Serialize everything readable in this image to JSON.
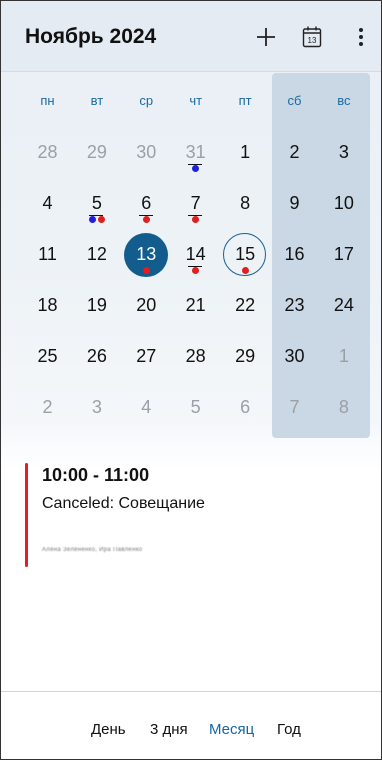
{
  "header": {
    "title": "Ноябрь 2024",
    "calendar_icon_number": "13"
  },
  "weekdays": [
    "пн",
    "вт",
    "ср",
    "чт",
    "пт",
    "сб",
    "вс"
  ],
  "weeks": [
    [
      {
        "n": "28",
        "muted": true
      },
      {
        "n": "29",
        "muted": true
      },
      {
        "n": "30",
        "muted": true
      },
      {
        "n": "31",
        "muted": true,
        "dots": [
          "blue"
        ],
        "underline": true
      },
      {
        "n": "1"
      },
      {
        "n": "2"
      },
      {
        "n": "3"
      }
    ],
    [
      {
        "n": "4"
      },
      {
        "n": "5",
        "dots": [
          "blue",
          "red"
        ],
        "underline": true
      },
      {
        "n": "6",
        "dots": [
          "red"
        ],
        "underline": true
      },
      {
        "n": "7",
        "dots": [
          "red"
        ],
        "underline": true
      },
      {
        "n": "8"
      },
      {
        "n": "9"
      },
      {
        "n": "10"
      }
    ],
    [
      {
        "n": "11"
      },
      {
        "n": "12"
      },
      {
        "n": "13",
        "dots": [
          "red"
        ],
        "selected": true
      },
      {
        "n": "14",
        "dots": [
          "red"
        ],
        "underline": true
      },
      {
        "n": "15",
        "dots": [
          "red"
        ],
        "today": true
      },
      {
        "n": "16"
      },
      {
        "n": "17"
      }
    ],
    [
      {
        "n": "18"
      },
      {
        "n": "19"
      },
      {
        "n": "20"
      },
      {
        "n": "21"
      },
      {
        "n": "22"
      },
      {
        "n": "23"
      },
      {
        "n": "24"
      }
    ],
    [
      {
        "n": "25"
      },
      {
        "n": "26"
      },
      {
        "n": "27"
      },
      {
        "n": "28"
      },
      {
        "n": "29"
      },
      {
        "n": "30"
      },
      {
        "n": "1",
        "muted": true
      }
    ],
    [
      {
        "n": "2",
        "muted": true
      },
      {
        "n": "3",
        "muted": true
      },
      {
        "n": "4",
        "muted": true
      },
      {
        "n": "5",
        "muted": true
      },
      {
        "n": "6",
        "muted": true
      },
      {
        "n": "7",
        "muted": true
      },
      {
        "n": "8",
        "muted": true
      }
    ]
  ],
  "colors": {
    "accent": "#135d8e",
    "dot_red": "#e11d1d",
    "dot_blue": "#1e1ee0",
    "event_bar": "#e31e24"
  },
  "event": {
    "time": "10:00 - 11:00",
    "title": "Canceled: Совещание",
    "attendees": "Алёна Зелёненко, Ира Павленко"
  },
  "bottom_nav": {
    "day": "День",
    "three_days": "3 дня",
    "month": "Месяц",
    "year": "Год",
    "active": "month"
  }
}
